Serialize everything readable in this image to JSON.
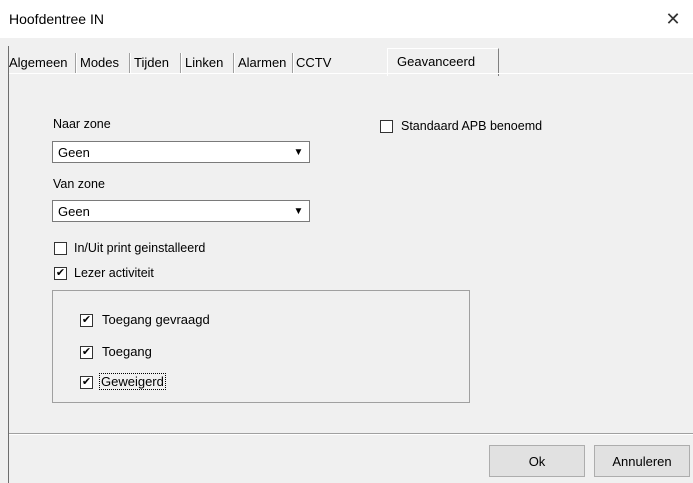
{
  "window": {
    "title": "Hoofdentree IN",
    "close_glyph": "✕"
  },
  "tabs": [
    "Algemeen",
    "Modes",
    "Tijden",
    "Linken",
    "Alarmen",
    "CCTV"
  ],
  "active_tab": "Geavanceerd",
  "naar_zone": {
    "label": "Naar zone",
    "value": "Geen"
  },
  "van_zone": {
    "label": "Van zone",
    "value": "Geen"
  },
  "checkboxes": {
    "standaard_apb": {
      "label": "Standaard APB benoemd",
      "checked": false
    },
    "inuit_print": {
      "label": "In/Uit print geinstalleerd",
      "checked": false
    },
    "lezer_activiteit": {
      "label": "Lezer activiteit",
      "checked": true
    },
    "toegang_gevraagd": {
      "label": "Toegang gevraagd",
      "checked": true
    },
    "toegang": {
      "label": "Toegang",
      "checked": true
    },
    "geweigerd": {
      "label": "Geweigerd",
      "checked": true
    }
  },
  "buttons": {
    "ok": "Ok",
    "cancel": "Annuleren"
  },
  "check_glyph": "✔",
  "dropdown_glyph": "▼"
}
